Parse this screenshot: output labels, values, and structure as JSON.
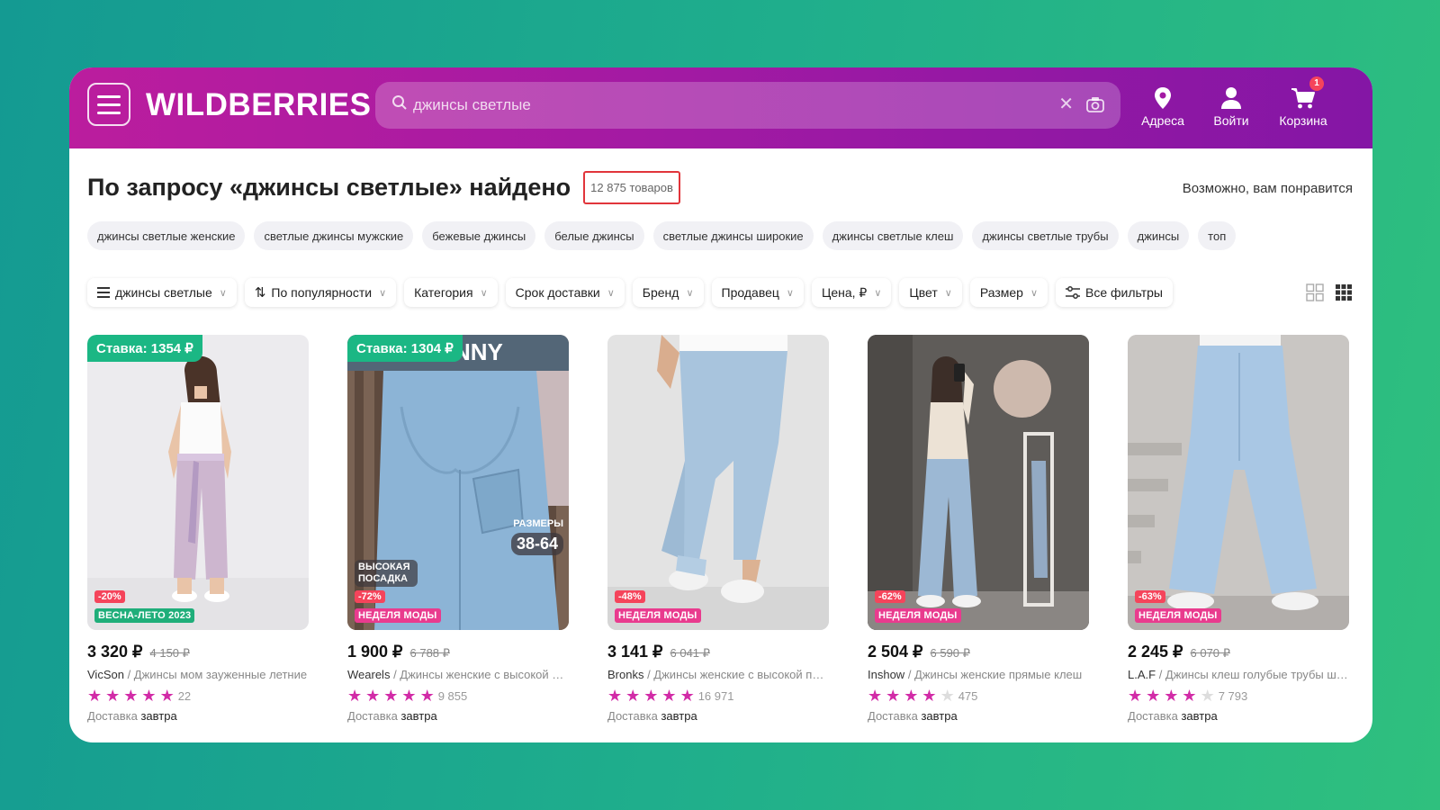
{
  "header": {
    "logo": "WILDBERRIES",
    "search_value": "джинсы светлые",
    "addresses_label": "Адреса",
    "login_label": "Войти",
    "cart_label": "Корзина",
    "cart_count": "1"
  },
  "results": {
    "title": "По запросу «джинсы светлые» найдено",
    "count": "12 875 товаров",
    "maybe_like": "Возможно, вам понравится"
  },
  "chips": [
    "джинсы светлые женские",
    "светлые джинсы мужские",
    "бежевые джинсы",
    "белые джинсы",
    "светлые джинсы широкие",
    "джинсы светлые клеш",
    "джинсы светлые трубы",
    "джинсы",
    "топ"
  ],
  "filters": {
    "query": "джинсы светлые",
    "sort": "По популярности",
    "category": "Категория",
    "delivery": "Срок доставки",
    "brand": "Бренд",
    "seller": "Продавец",
    "price": "Цена, ₽",
    "color": "Цвет",
    "size": "Размер",
    "all": "Все фильтры"
  },
  "products": [
    {
      "stake": "Ставка: 1354 ₽",
      "discount": "-20%",
      "tag": "ВЕСНА-ЛЕТО 2023",
      "price": "3 320 ₽",
      "old_price": "4 150 ₽",
      "brand": "VicSon",
      "name": " / Джинсы мом зауженные летние",
      "stars": 5,
      "reviews": "22",
      "delivery_label": "Доставка",
      "delivery_when": "завтра"
    },
    {
      "stake": "Ставка: 1304 ₽",
      "banner": "NNY",
      "height_text": "ВЫСОКАЯ ПОСАДКА",
      "sizes_label": "РАЗМЕРЫ",
      "sizes": "38-64",
      "discount": "-72%",
      "tag": "НЕДЕЛЯ МОДЫ",
      "price": "1 900 ₽",
      "old_price": "6 788 ₽",
      "brand": "Wearels",
      "name": " / Джинсы женские с высокой посадкой",
      "stars": 5,
      "reviews": "9 855",
      "delivery_label": "Доставка",
      "delivery_when": "завтра"
    },
    {
      "discount": "-48%",
      "tag": "НЕДЕЛЯ МОДЫ",
      "price": "3 141 ₽",
      "old_price": "6 041 ₽",
      "brand": "Bronks",
      "name": " / Джинсы женские с высокой посадкой",
      "stars": 5,
      "reviews": "16 971",
      "delivery_label": "Доставка",
      "delivery_when": "завтра"
    },
    {
      "discount": "-62%",
      "tag": "НЕДЕЛЯ МОДЫ",
      "price": "2 504 ₽",
      "old_price": "6 590 ₽",
      "brand": "Inshow",
      "name": " / Джинсы женские прямые клеш",
      "stars": 4,
      "reviews": "475",
      "delivery_label": "Доставка",
      "delivery_when": "завтра"
    },
    {
      "discount": "-63%",
      "tag": "НЕДЕЛЯ МОДЫ",
      "price": "2 245 ₽",
      "old_price": "6 070 ₽",
      "brand": "L.A.F",
      "name": " / Джинсы клеш голубые трубы широкие",
      "stars": 4,
      "reviews": "7 793",
      "delivery_label": "Доставка",
      "delivery_when": "завтра"
    }
  ]
}
